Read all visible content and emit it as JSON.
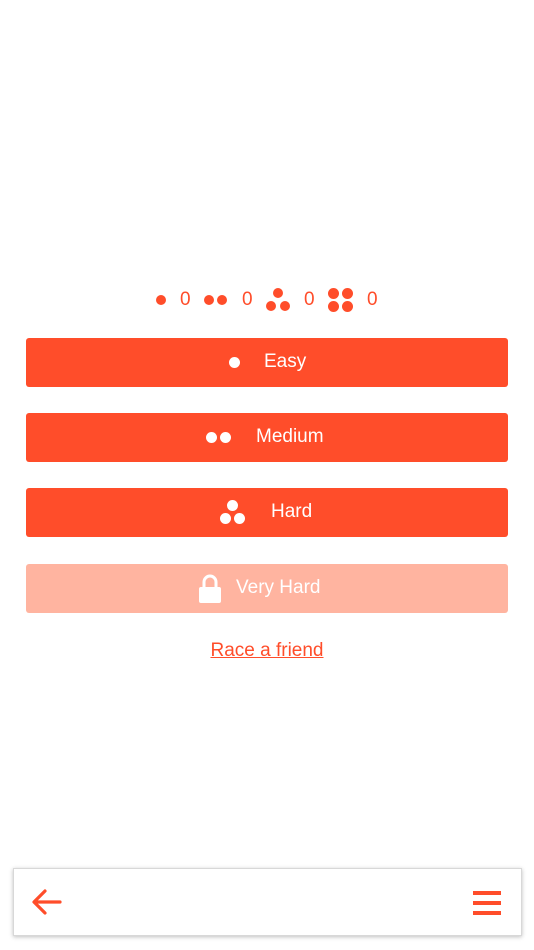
{
  "colors": {
    "accent": "#FF4D2A",
    "accent_disabled": "#FFB4A0",
    "background": "#FFFFFF"
  },
  "scores": [
    {
      "level": "easy",
      "icon": "one-dot-icon",
      "value": "0"
    },
    {
      "level": "medium",
      "icon": "two-dots-icon",
      "value": "0"
    },
    {
      "level": "hard",
      "icon": "three-dots-icon",
      "value": "0"
    },
    {
      "level": "very-hard",
      "icon": "four-dots-icon",
      "value": "0"
    }
  ],
  "levels": [
    {
      "label": "Easy",
      "icon": "one-dot-icon",
      "locked": false
    },
    {
      "label": "Medium",
      "icon": "two-dots-icon",
      "locked": false
    },
    {
      "label": "Hard",
      "icon": "three-dots-icon",
      "locked": false
    },
    {
      "label": "Very Hard",
      "icon": "lock-icon",
      "locked": true
    }
  ],
  "race_link": "Race a friend",
  "bottom_bar": {
    "back_icon": "arrow-left-icon",
    "menu_icon": "hamburger-menu-icon"
  }
}
